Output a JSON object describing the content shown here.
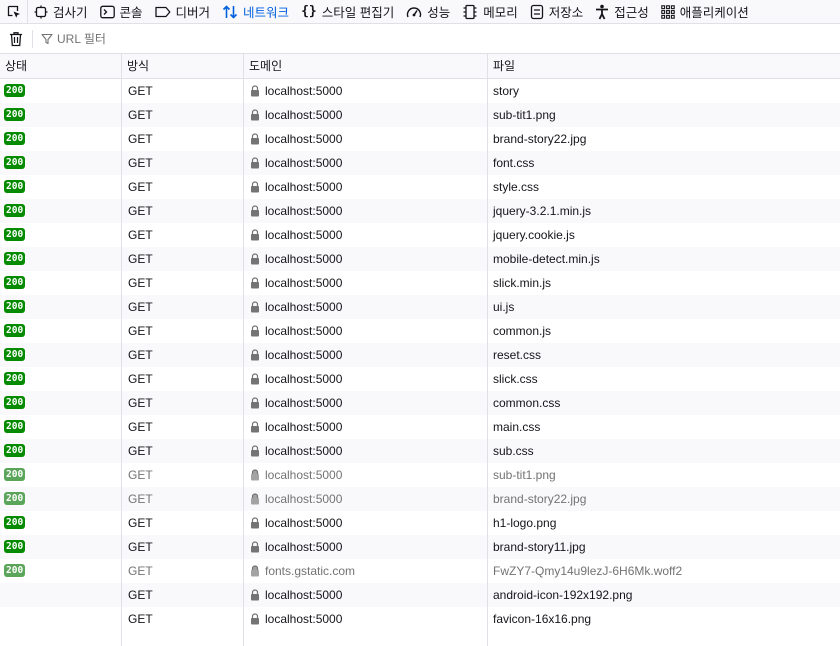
{
  "toolbar": {
    "tabs": [
      {
        "label": "검사기",
        "icon": "inspector-icon"
      },
      {
        "label": "콘솔",
        "icon": "console-icon"
      },
      {
        "label": "디버거",
        "icon": "debugger-icon"
      },
      {
        "label": "네트워크",
        "icon": "network-icon",
        "selected": true
      },
      {
        "label": "스타일 편집기",
        "icon": "style-editor-icon"
      },
      {
        "label": "성능",
        "icon": "performance-icon"
      },
      {
        "label": "메모리",
        "icon": "memory-icon"
      },
      {
        "label": "저장소",
        "icon": "storage-icon"
      },
      {
        "label": "접근성",
        "icon": "accessibility-icon"
      },
      {
        "label": "애플리케이션",
        "icon": "application-icon"
      }
    ]
  },
  "filter": {
    "placeholder": "URL 필터"
  },
  "table": {
    "columns": {
      "status": "상태",
      "method": "방식",
      "domain": "도메인",
      "file": "파일"
    },
    "rows": [
      {
        "status": "200",
        "method": "GET",
        "domain": "localhost:5000",
        "file": "story"
      },
      {
        "status": "200",
        "method": "GET",
        "domain": "localhost:5000",
        "file": "sub-tit1.png"
      },
      {
        "status": "200",
        "method": "GET",
        "domain": "localhost:5000",
        "file": "brand-story22.jpg"
      },
      {
        "status": "200",
        "method": "GET",
        "domain": "localhost:5000",
        "file": "font.css"
      },
      {
        "status": "200",
        "method": "GET",
        "domain": "localhost:5000",
        "file": "style.css"
      },
      {
        "status": "200",
        "method": "GET",
        "domain": "localhost:5000",
        "file": "jquery-3.2.1.min.js"
      },
      {
        "status": "200",
        "method": "GET",
        "domain": "localhost:5000",
        "file": "jquery.cookie.js"
      },
      {
        "status": "200",
        "method": "GET",
        "domain": "localhost:5000",
        "file": "mobile-detect.min.js"
      },
      {
        "status": "200",
        "method": "GET",
        "domain": "localhost:5000",
        "file": "slick.min.js"
      },
      {
        "status": "200",
        "method": "GET",
        "domain": "localhost:5000",
        "file": "ui.js"
      },
      {
        "status": "200",
        "method": "GET",
        "domain": "localhost:5000",
        "file": "common.js"
      },
      {
        "status": "200",
        "method": "GET",
        "domain": "localhost:5000",
        "file": "reset.css"
      },
      {
        "status": "200",
        "method": "GET",
        "domain": "localhost:5000",
        "file": "slick.css"
      },
      {
        "status": "200",
        "method": "GET",
        "domain": "localhost:5000",
        "file": "common.css"
      },
      {
        "status": "200",
        "method": "GET",
        "domain": "localhost:5000",
        "file": "main.css"
      },
      {
        "status": "200",
        "method": "GET",
        "domain": "localhost:5000",
        "file": "sub.css"
      },
      {
        "status": "200",
        "method": "GET",
        "domain": "localhost:5000",
        "file": "sub-tit1.png",
        "cached": true
      },
      {
        "status": "200",
        "method": "GET",
        "domain": "localhost:5000",
        "file": "brand-story22.jpg",
        "cached": true
      },
      {
        "status": "200",
        "method": "GET",
        "domain": "localhost:5000",
        "file": "h1-logo.png"
      },
      {
        "status": "200",
        "method": "GET",
        "domain": "localhost:5000",
        "file": "brand-story11.jpg"
      },
      {
        "status": "200",
        "method": "GET",
        "domain": "fonts.gstatic.com",
        "file": "FwZY7-Qmy14u9lezJ-6H6Mk.woff2",
        "cached": true
      },
      {
        "status": "",
        "method": "GET",
        "domain": "localhost:5000",
        "file": "android-icon-192x192.png"
      },
      {
        "status": "",
        "method": "GET",
        "domain": "localhost:5000",
        "file": "favicon-16x16.png"
      }
    ]
  },
  "colors": {
    "accent": "#0060df",
    "status_ok": "#058b00",
    "status_cached": "#5ba55b",
    "stripe": "#f9f9fb",
    "border": "#e0e0e6"
  }
}
